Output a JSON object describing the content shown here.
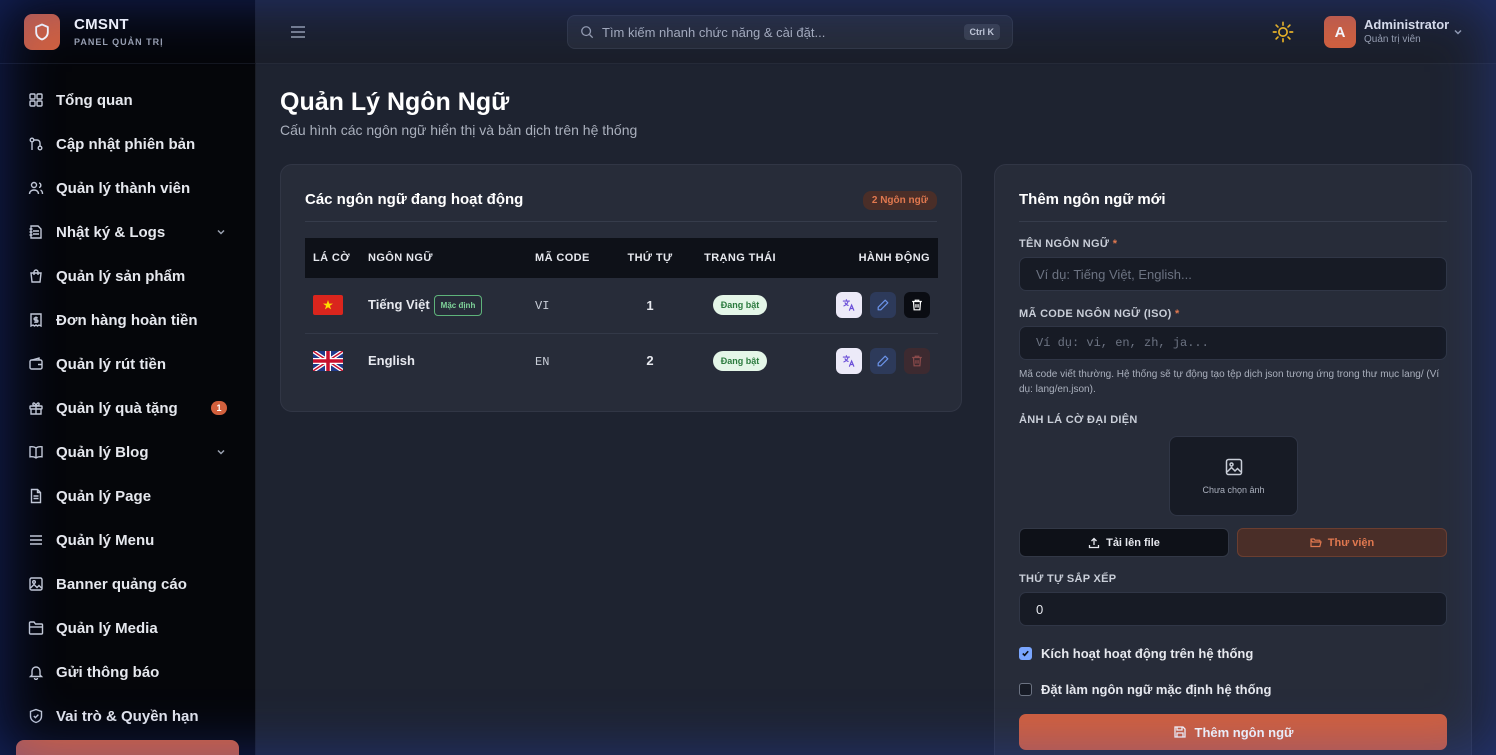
{
  "brand": {
    "name": "CMSNT",
    "subtitle": "PANEL QUẢN TRỊ"
  },
  "sidebar": {
    "items": [
      {
        "label": "Tổng quan",
        "icon": "grid-icon"
      },
      {
        "label": "Cập nhật phiên bản",
        "icon": "git-icon"
      },
      {
        "label": "Quản lý thành viên",
        "icon": "users-icon"
      },
      {
        "label": "Nhật ký & Logs",
        "icon": "log-icon",
        "has_chevron": true
      },
      {
        "label": "Quản lý sản phẩm",
        "icon": "bag-icon"
      },
      {
        "label": "Đơn hàng hoàn tiền",
        "icon": "receipt-icon"
      },
      {
        "label": "Quản lý rút tiền",
        "icon": "wallet-icon"
      },
      {
        "label": "Quản lý quà tặng",
        "icon": "gift-icon",
        "badge": "1"
      },
      {
        "label": "Quản lý Blog",
        "icon": "book-icon",
        "has_chevron": true
      },
      {
        "label": "Quản lý Page",
        "icon": "page-icon"
      },
      {
        "label": "Quản lý Menu",
        "icon": "menu-icon"
      },
      {
        "label": "Banner quảng cáo",
        "icon": "image-icon"
      },
      {
        "label": "Quản lý Media",
        "icon": "folder-icon"
      },
      {
        "label": "Gửi thông báo",
        "icon": "bell-icon"
      },
      {
        "label": "Vai trò & Quyền hạn",
        "icon": "shield-icon"
      }
    ]
  },
  "topbar": {
    "search_placeholder": "Tìm kiếm nhanh chức năng & cài đặt...",
    "search_shortcut": "Ctrl K",
    "user": {
      "initial": "A",
      "name": "Administrator",
      "role": "Quản trị viên"
    }
  },
  "page": {
    "title": "Quản Lý Ngôn Ngữ",
    "subtitle": "Cấu hình các ngôn ngữ hiển thị và bản dịch trên hệ thống"
  },
  "languages_card": {
    "title": "Các ngôn ngữ đang hoạt động",
    "count_badge": "2 Ngôn ngữ",
    "columns": [
      "LÁ CỜ",
      "NGÔN NGỮ",
      "MÃ CODE",
      "THỨ TỰ",
      "TRẠNG THÁI",
      "HÀNH ĐỘNG"
    ],
    "rows": [
      {
        "flag": "vietnam-flag",
        "name": "Tiếng Việt",
        "default_badge": "Mặc định",
        "code": "VI",
        "order": "1",
        "status": "Đang bật",
        "delete_enabled": true
      },
      {
        "flag": "uk-flag",
        "name": "English",
        "default_badge": "",
        "code": "EN",
        "order": "2",
        "status": "Đang bật",
        "delete_enabled": false
      }
    ]
  },
  "form": {
    "title": "Thêm ngôn ngữ mới",
    "name_label": "TÊN NGÔN NGỮ",
    "name_placeholder": "Ví dụ: Tiếng Việt, English...",
    "code_label": "MÃ CODE NGÔN NGỮ (ISO)",
    "code_placeholder": "Ví dụ: vi, en, zh, ja...",
    "code_hint": "Mã code viết thường. Hệ thống sẽ tự động tạo tệp dịch json tương ứng trong thư mục lang/ (Ví dụ: lang/en.json).",
    "required_mark": "*",
    "flag_label": "ẢNH LÁ CỜ ĐẠI DIỆN",
    "flag_empty": "Chưa chọn ảnh",
    "upload_button": "Tải lên file",
    "library_button": "Thư viện",
    "order_label": "THỨ TỰ SẮP XẾP",
    "order_value": "0",
    "activate_label": "Kích hoạt hoạt động trên hệ thống",
    "activate_checked": true,
    "default_label": "Đặt làm ngôn ngữ mặc định hệ thống",
    "default_checked": false,
    "submit_button": "Thêm ngôn ngữ"
  },
  "colors": {
    "accent": "#d2603d",
    "background": "#1e2330",
    "card": "#272c39",
    "sidebar": "#05060a"
  }
}
